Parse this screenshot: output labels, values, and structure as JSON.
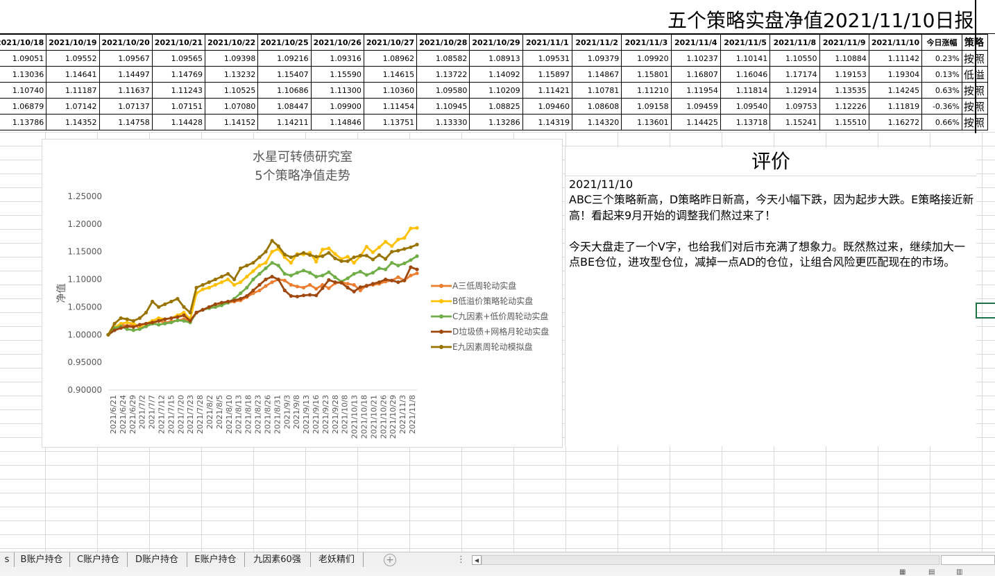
{
  "report": {
    "title": "五个策略实盘净值2021/11/10日报"
  },
  "table": {
    "dates": [
      "2021/10/18",
      "2021/10/19",
      "2021/10/20",
      "2021/10/21",
      "2021/10/22",
      "2021/10/25",
      "2021/10/26",
      "2021/10/27",
      "2021/10/28",
      "2021/10/29",
      "2021/11/1",
      "2021/11/2",
      "2021/11/3",
      "2021/11/4",
      "2021/11/5",
      "2021/11/8",
      "2021/11/9",
      "2021/11/10"
    ],
    "change_header": "今日涨幅",
    "strategy_header": "策略",
    "rows": [
      {
        "values": [
          "1.09051",
          "1.09552",
          "1.09567",
          "1.09565",
          "1.09398",
          "1.09216",
          "1.09316",
          "1.08962",
          "1.08582",
          "1.08913",
          "1.09531",
          "1.09379",
          "1.09920",
          "1.10237",
          "1.10141",
          "1.10550",
          "1.10884",
          "1.11142"
        ],
        "change": "0.23%",
        "strategy": "按照"
      },
      {
        "values": [
          "1.13036",
          "1.14641",
          "1.14497",
          "1.14769",
          "1.13232",
          "1.15407",
          "1.15590",
          "1.14615",
          "1.13722",
          "1.14092",
          "1.15897",
          "1.14867",
          "1.15801",
          "1.16807",
          "1.16046",
          "1.17174",
          "1.19153",
          "1.19304"
        ],
        "change": "0.13%",
        "strategy": "低溢"
      },
      {
        "values": [
          "1.10740",
          "1.11187",
          "1.11637",
          "1.11243",
          "1.10525",
          "1.10686",
          "1.11300",
          "1.10360",
          "1.09580",
          "1.10209",
          "1.11421",
          "1.10781",
          "1.11210",
          "1.11954",
          "1.11814",
          "1.12914",
          "1.13535",
          "1.14245"
        ],
        "change": "0.63%",
        "strategy": "按照"
      },
      {
        "values": [
          "1.06879",
          "1.07142",
          "1.07137",
          "1.07151",
          "1.07080",
          "1.08447",
          "1.09900",
          "1.11454",
          "1.10945",
          "1.08825",
          "1.09460",
          "1.08608",
          "1.09158",
          "1.09459",
          "1.09540",
          "1.09753",
          "1.12226",
          "1.11819"
        ],
        "change": "-0.36%",
        "strategy": "按照"
      },
      {
        "values": [
          "1.13786",
          "1.14352",
          "1.14758",
          "1.14428",
          "1.14152",
          "1.14211",
          "1.14846",
          "1.13751",
          "1.13330",
          "1.13286",
          "1.14319",
          "1.14320",
          "1.13601",
          "1.14425",
          "1.13718",
          "1.15241",
          "1.15510",
          "1.16272"
        ],
        "change": "0.66%",
        "strategy": "按照"
      }
    ]
  },
  "chart_data": {
    "type": "line",
    "title": "水星可转债研究室",
    "subtitle": "5个策略净值走势",
    "ylabel": "净值",
    "ylim": [
      0.9,
      1.25
    ],
    "yticks": [
      "1.25000",
      "1.20000",
      "1.15000",
      "1.10000",
      "1.05000",
      "1.00000",
      "0.95000",
      "0.90000"
    ],
    "legend_position": "right",
    "x_tick_labels": [
      "2021/6/21",
      "2021/6/24",
      "2021/6/29",
      "2021/7/2",
      "2021/7/7",
      "2021/7/12",
      "2021/7/15",
      "2021/7/20",
      "2021/7/23",
      "2021/7/28",
      "2021/8/2",
      "2021/8/5",
      "2021/8/10",
      "2021/8/13",
      "2021/8/18",
      "2021/8/23",
      "2021/8/26",
      "2021/8/31",
      "2021/9/3",
      "2021/9/8",
      "2021/9/13",
      "2021/9/16",
      "2021/9/23",
      "2021/9/28",
      "2021/10/8",
      "2021/10/13",
      "2021/10/18",
      "2021/10/21",
      "2021/10/26",
      "2021/10/29",
      "2021/11/3",
      "2021/11/8"
    ],
    "series": [
      {
        "name": "A三低周轮动实盘",
        "color": "#ED7D31",
        "values": [
          1.0,
          1.01,
          1.018,
          1.016,
          1.018,
          1.012,
          1.015,
          1.02,
          1.025,
          1.022,
          1.024,
          1.026,
          1.028,
          1.025,
          1.04,
          1.045,
          1.048,
          1.05,
          1.055,
          1.058,
          1.06,
          1.062,
          1.068,
          1.075,
          1.08,
          1.088,
          1.095,
          1.1,
          1.098,
          1.09,
          1.087,
          1.085,
          1.09,
          1.083,
          1.09,
          1.084,
          1.093,
          1.095,
          1.092,
          1.09,
          1.08,
          1.089,
          1.09,
          1.092,
          1.096,
          1.098,
          1.104,
          1.098,
          1.107,
          1.111
        ]
      },
      {
        "name": "B低溢价策略轮动实盘",
        "color": "#FFC000",
        "values": [
          1.0,
          1.013,
          1.02,
          1.022,
          1.02,
          1.015,
          1.02,
          1.025,
          1.03,
          1.028,
          1.03,
          1.035,
          1.04,
          1.028,
          1.075,
          1.082,
          1.085,
          1.09,
          1.095,
          1.1,
          1.09,
          1.095,
          1.105,
          1.115,
          1.125,
          1.13,
          1.15,
          1.155,
          1.14,
          1.13,
          1.146,
          1.145,
          1.148,
          1.132,
          1.154,
          1.156,
          1.146,
          1.137,
          1.141,
          1.13,
          1.142,
          1.159,
          1.149,
          1.158,
          1.168,
          1.16,
          1.172,
          1.175,
          1.192,
          1.193
        ]
      },
      {
        "name": "C九因素+低价周轮动实盘",
        "color": "#70AD47",
        "values": [
          1.0,
          1.012,
          1.015,
          1.01,
          1.008,
          1.01,
          1.015,
          1.02,
          1.018,
          1.02,
          1.022,
          1.026,
          1.025,
          1.022,
          1.04,
          1.045,
          1.048,
          1.05,
          1.053,
          1.058,
          1.065,
          1.075,
          1.085,
          1.1,
          1.11,
          1.12,
          1.13,
          1.125,
          1.11,
          1.107,
          1.112,
          1.116,
          1.112,
          1.105,
          1.107,
          1.113,
          1.104,
          1.096,
          1.102,
          1.11,
          1.114,
          1.108,
          1.112,
          1.12,
          1.118,
          1.13,
          1.125,
          1.129,
          1.135,
          1.142
        ]
      },
      {
        "name": "D垃圾债+网格月轮动实盘",
        "color": "#9E480E",
        "values": [
          1.0,
          1.008,
          1.012,
          1.015,
          1.014,
          1.018,
          1.02,
          1.022,
          1.025,
          1.028,
          1.03,
          1.032,
          1.035,
          1.025,
          1.04,
          1.045,
          1.05,
          1.055,
          1.058,
          1.06,
          1.062,
          1.065,
          1.07,
          1.08,
          1.09,
          1.1,
          1.105,
          1.1,
          1.08,
          1.07,
          1.069,
          1.071,
          1.072,
          1.071,
          1.084,
          1.099,
          1.095,
          1.094,
          1.085,
          1.078,
          1.086,
          1.088,
          1.092,
          1.095,
          1.1,
          1.098,
          1.095,
          1.098,
          1.122,
          1.118
        ]
      },
      {
        "name": "E九因素周轮动模拟盘",
        "color": "#997300",
        "values": [
          1.0,
          1.02,
          1.03,
          1.028,
          1.025,
          1.03,
          1.04,
          1.06,
          1.05,
          1.055,
          1.06,
          1.065,
          1.05,
          1.04,
          1.085,
          1.09,
          1.095,
          1.1,
          1.105,
          1.11,
          1.1,
          1.12,
          1.125,
          1.13,
          1.14,
          1.15,
          1.17,
          1.16,
          1.145,
          1.14,
          1.144,
          1.148,
          1.144,
          1.141,
          1.142,
          1.148,
          1.138,
          1.133,
          1.133,
          1.14,
          1.143,
          1.143,
          1.136,
          1.144,
          1.137,
          1.15,
          1.152,
          1.155,
          1.158,
          1.163
        ]
      }
    ]
  },
  "commentary": {
    "title": "评价",
    "date": "2021/11/10",
    "body": "ABC三个策略新高，D策略昨日新高，今天小幅下跌，因为起步大跌。E策略接近新高！看起来9月开始的调整我们熬过来了！\n\n今天大盘走了一个V字，也给我们对后市充满了想象力。既然熬过来，继续加大一点BE仓位，进攻型仓位，减掉一点AD的仓位，让组合风险更匹配现在的市场。"
  },
  "sheet_tabs": [
    {
      "label": "s"
    },
    {
      "label": "B账户持仓"
    },
    {
      "label": "C账户持仓"
    },
    {
      "label": "D账户持仓"
    },
    {
      "label": "E账户持仓"
    },
    {
      "label": "九因素60强"
    },
    {
      "label": "老妖精们"
    }
  ],
  "icons": {
    "add": "add-sheet-icon",
    "split": "tab-split-icon",
    "scroll_left": "scroll-left-icon"
  }
}
